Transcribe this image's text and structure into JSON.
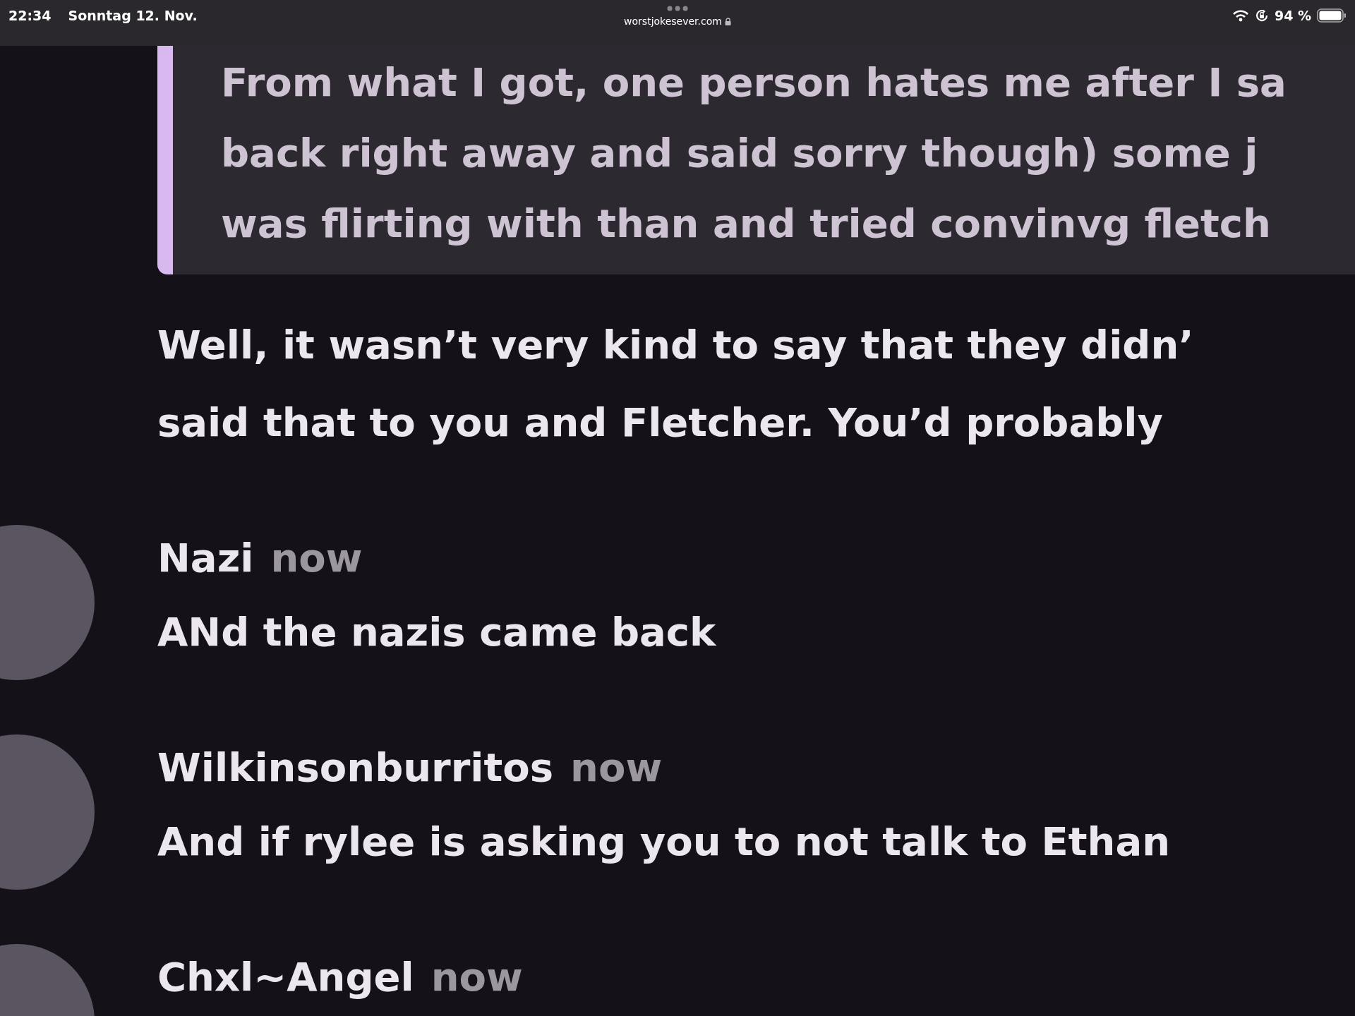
{
  "status_bar": {
    "time": "22:34",
    "date": "Sonntag 12. Nov.",
    "url": "worstjokesever.com",
    "battery": "94 %"
  },
  "messages": [
    {
      "kind": "quote",
      "lines": [
        "From what I got, one person hates me after I sa",
        "back right away and said sorry though) some j",
        "was flirting with than and tried convinvg fletch"
      ]
    },
    {
      "kind": "text",
      "lines": [
        "Well, it wasn’t very kind to say that they didn’",
        "said that to you and Fletcher. You’d probably"
      ]
    },
    {
      "kind": "post",
      "author": "Nazi",
      "time": "now",
      "lines": [
        "ANd the nazis came back"
      ]
    },
    {
      "kind": "post",
      "author": "Wilkinsonburritos",
      "time": "now",
      "lines": [
        "And if rylee is asking you to not talk to Ethan"
      ]
    },
    {
      "kind": "post",
      "author": "Chxl~Angel",
      "time": "now"
    }
  ]
}
